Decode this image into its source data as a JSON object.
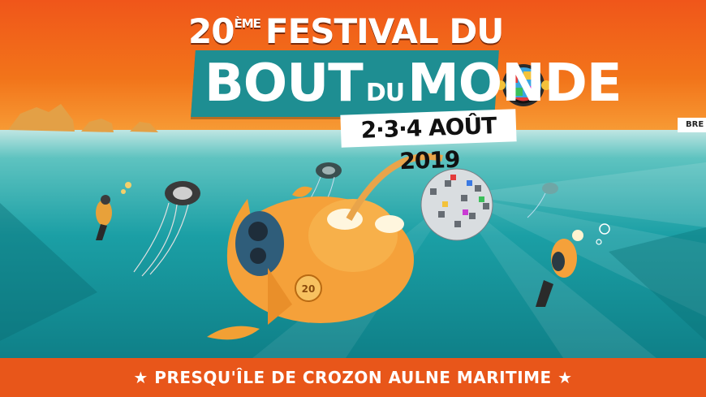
{
  "poster": {
    "edition": "20",
    "edition_suffix": "ÈME",
    "title_line1": "FESTIVAL DU",
    "title_bout": "BOUT",
    "title_du": "DU",
    "title_monde": "MONDE",
    "dates": "2·3·4 AOÛT 2019",
    "footer": "★ PRESQU'ÎLE DE CROZON AULNE MARITIME ★",
    "corner_tag": "BRE",
    "badge_number": "20"
  },
  "colors": {
    "sky_orange": "#f0561a",
    "sea_teal": "#1b9fa5",
    "banner_teal": "#1e8e92",
    "fish_orange": "#f5a13a"
  },
  "icons": [
    "disco-ball-icon",
    "fish-submarine-icon",
    "jellyfish-speaker-icon",
    "diver-icon",
    "globe-mascot-icon"
  ]
}
